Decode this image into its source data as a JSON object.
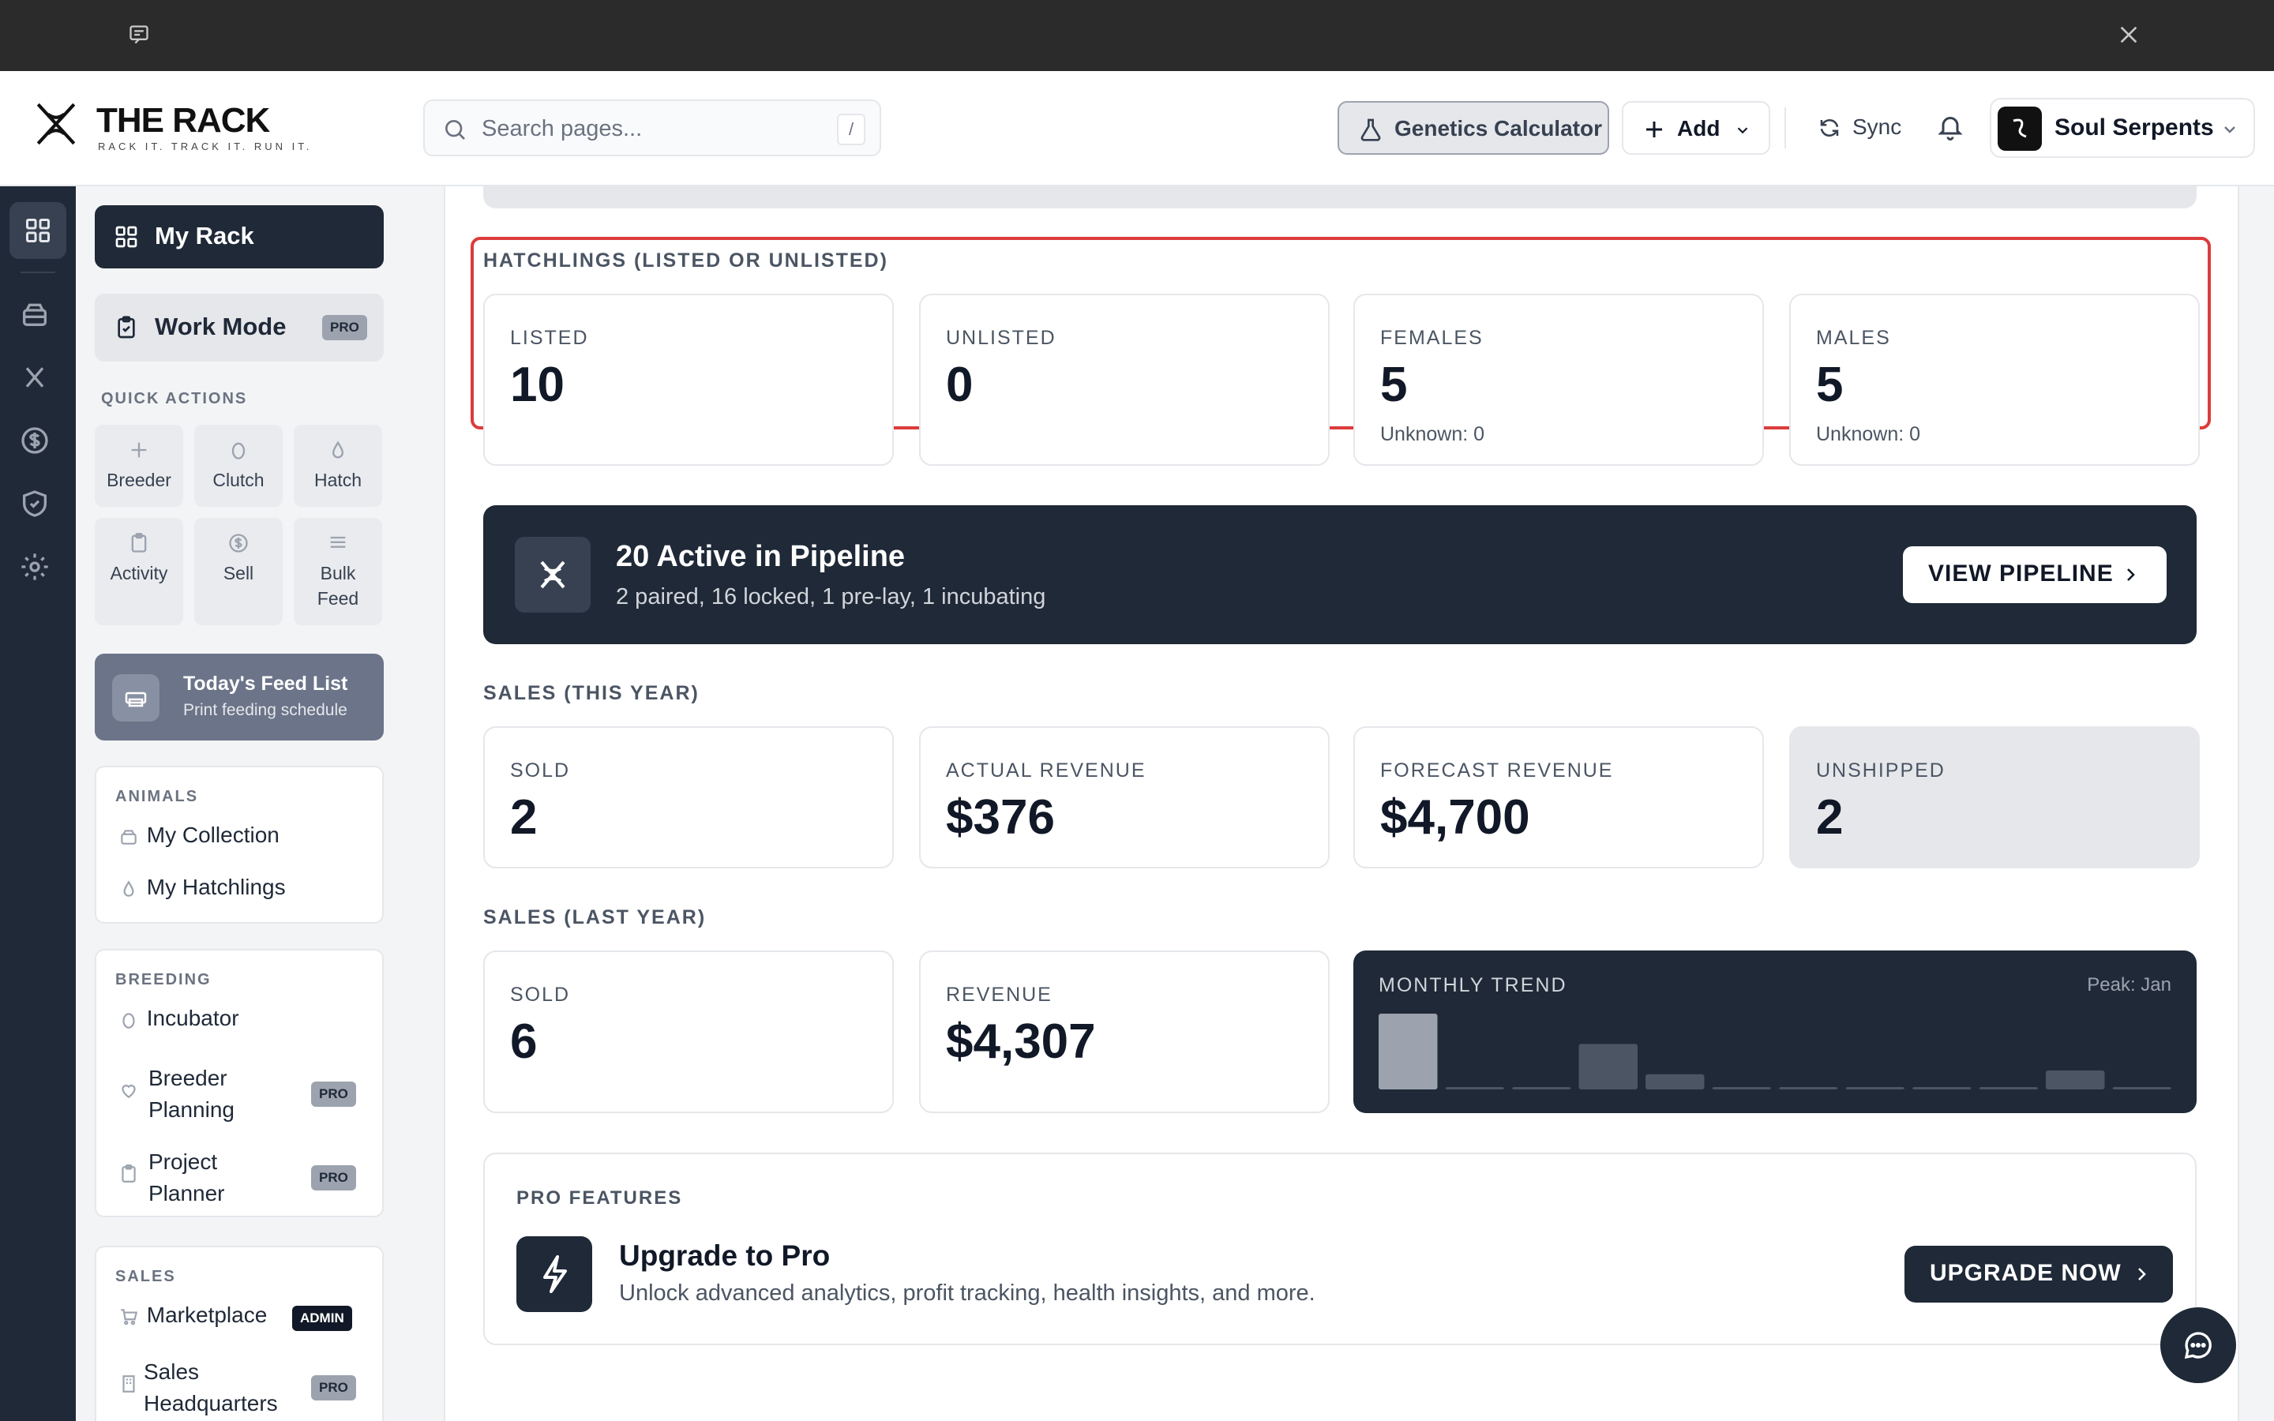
{
  "header": {
    "logo_title": "THE RACK",
    "logo_subtitle": "RACK IT. TRACK IT. RUN IT.",
    "search_placeholder": "Search pages...",
    "search_shortcut": "/",
    "genetics_label": "Genetics Calculator",
    "add_label": "Add",
    "sync_label": "Sync",
    "account_name": "Soul Serpents"
  },
  "sidebar": {
    "my_rack": "My Rack",
    "work_mode": "Work Mode",
    "pro_badge": "PRO",
    "admin_badge": "ADMIN",
    "quick_actions_title": "QUICK ACTIONS",
    "quick_actions": [
      {
        "label": "Breeder",
        "icon": "plus-icon"
      },
      {
        "label": "Clutch",
        "icon": "egg-icon"
      },
      {
        "label": "Hatch",
        "icon": "drop-icon"
      },
      {
        "label": "Activity",
        "icon": "clipboard-icon"
      },
      {
        "label": "Sell",
        "icon": "dollar-icon"
      },
      {
        "label": "Bulk Feed",
        "icon": "list-icon"
      }
    ],
    "feed_title": "Today's Feed List",
    "feed_sub": "Print feeding schedule",
    "animals": {
      "title": "ANIMALS",
      "items": [
        "My Collection",
        "My Hatchlings"
      ]
    },
    "breeding": {
      "title": "BREEDING",
      "items": [
        "Incubator",
        "Breeder Planning",
        "Project Planner"
      ]
    },
    "sales": {
      "title": "SALES",
      "items": [
        "Marketplace",
        "Sales Headquarters"
      ]
    }
  },
  "main": {
    "hatchlings_title": "HATCHLINGS (LISTED OR UNLISTED)",
    "hatchlings": [
      {
        "label": "LISTED",
        "value": "10",
        "sub": ""
      },
      {
        "label": "UNLISTED",
        "value": "0",
        "sub": ""
      },
      {
        "label": "FEMALES",
        "value": "5",
        "sub": "Unknown: 0"
      },
      {
        "label": "MALES",
        "value": "5",
        "sub": "Unknown: 0"
      }
    ],
    "pipeline": {
      "title": "20 Active in Pipeline",
      "detail": "2 paired, 16 locked, 1 pre-lay, 1 incubating",
      "button": "VIEW PIPELINE"
    },
    "sales_this_year_title": "SALES (THIS YEAR)",
    "sales_this_year": [
      {
        "label": "SOLD",
        "value": "2"
      },
      {
        "label": "ACTUAL REVENUE",
        "value": "$376"
      },
      {
        "label": "FORECAST REVENUE",
        "value": "$4,700"
      },
      {
        "label": "UNSHIPPED",
        "value": "2"
      }
    ],
    "sales_last_year_title": "SALES (LAST YEAR)",
    "sales_last_year": [
      {
        "label": "SOLD",
        "value": "6"
      },
      {
        "label": "REVENUE",
        "value": "$4,307"
      }
    ],
    "trend": {
      "label": "MONTHLY TREND",
      "peak": "Peak: Jan",
      "bars": [
        1.0,
        0.03,
        0.03,
        0.6,
        0.2,
        0.03,
        0.03,
        0.03,
        0.03,
        0.03,
        0.25,
        0.03
      ]
    },
    "pro": {
      "title": "PRO FEATURES",
      "heading": "Upgrade to Pro",
      "desc": "Unlock advanced analytics, profit tracking, health insights, and more.",
      "button": "UPGRADE NOW"
    }
  },
  "colors": {
    "dark": "#1f2937",
    "highlight": "#dc3c3c",
    "accent_grey": "#9ca3af"
  }
}
